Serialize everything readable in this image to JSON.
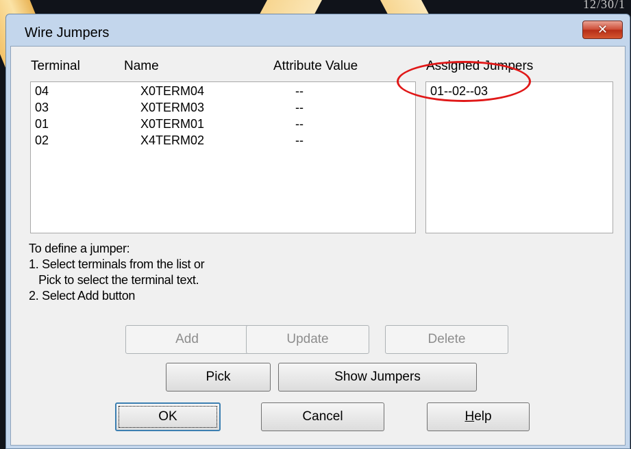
{
  "background": {
    "corner_text": "12/30/1"
  },
  "dialog": {
    "title": "Wire Jumpers",
    "close_glyph": "✕"
  },
  "columns": {
    "terminal": "Terminal",
    "name": "Name",
    "attribute_value": "Attribute Value",
    "assigned_jumpers": "Assigned Jumpers"
  },
  "terminals": [
    {
      "terminal": "04",
      "name": "X0TERM04",
      "value": "--"
    },
    {
      "terminal": "03",
      "name": "X0TERM03",
      "value": "--"
    },
    {
      "terminal": "01",
      "name": "X0TERM01",
      "value": "--"
    },
    {
      "terminal": "02",
      "name": "X4TERM02",
      "value": "--"
    }
  ],
  "assigned_jumpers": [
    "01--02--03"
  ],
  "instructions": {
    "line1": "To define a jumper:",
    "line2": "1. Select terminals from the list or",
    "line3": "   Pick to select the terminal text.",
    "line4": "2. Select Add button"
  },
  "buttons": {
    "add": "Add",
    "update": "Update",
    "delete": "Delete",
    "pick": "Pick",
    "show_jumpers": "Show Jumpers",
    "ok": "OK",
    "cancel": "Cancel",
    "help_prefix": "",
    "help_mnemonic": "H",
    "help_rest": "elp"
  },
  "colors": {
    "annotation_circle": "#e01818",
    "window_frame": "#c3d6ec",
    "close_button": "#cc4a33"
  }
}
